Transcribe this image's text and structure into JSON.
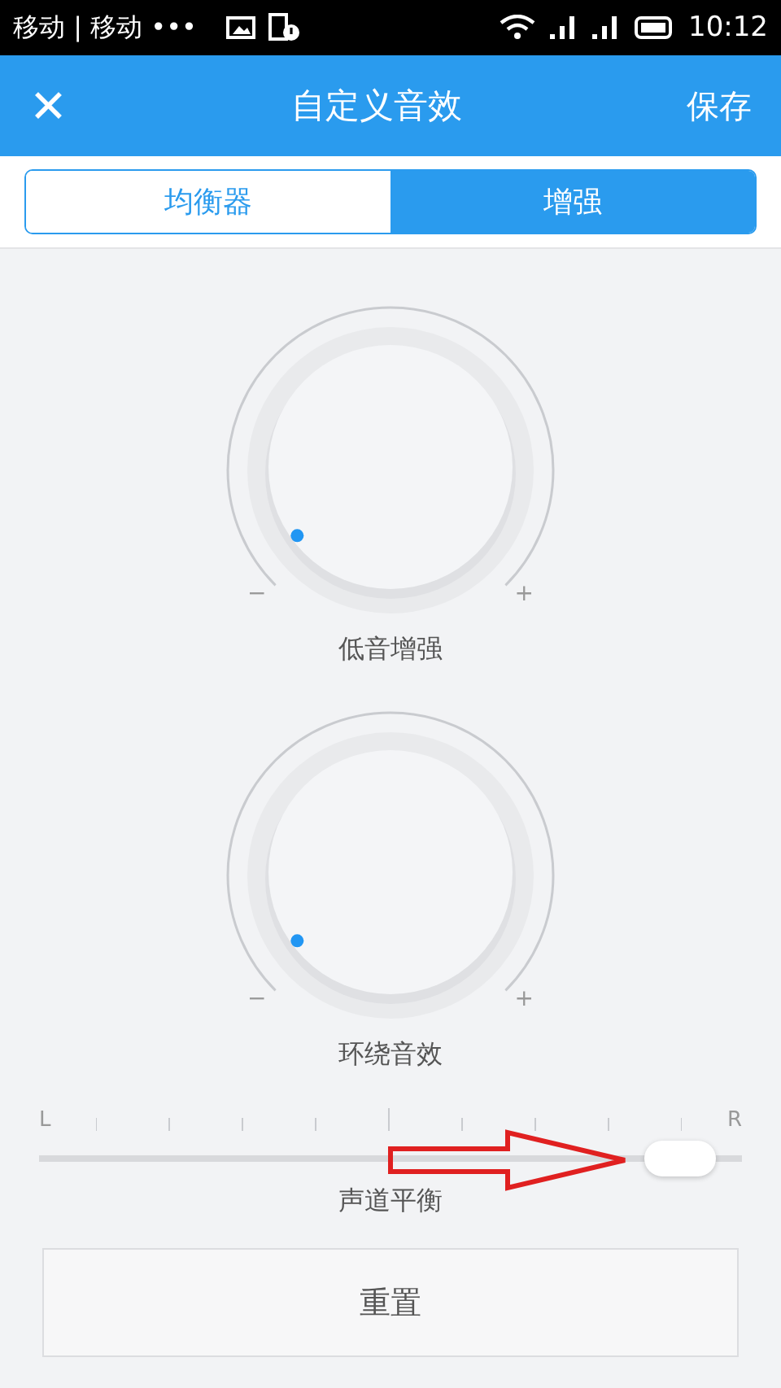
{
  "status_bar": {
    "carriers": "移动 | 移动 •••",
    "time": "10:12"
  },
  "header": {
    "close": "✕",
    "title": "自定义音效",
    "save": "保存"
  },
  "tabs": [
    {
      "label": "均衡器",
      "selected": false
    },
    {
      "label": "增强",
      "selected": true
    }
  ],
  "knobs": [
    {
      "label": "低音增强",
      "minus": "−",
      "plus": "+"
    },
    {
      "label": "环绕音效",
      "minus": "−",
      "plus": "+"
    }
  ],
  "balance": {
    "left": "L",
    "right": "R",
    "level": 0.96,
    "label": "声道平衡"
  },
  "reset_button": "重置"
}
